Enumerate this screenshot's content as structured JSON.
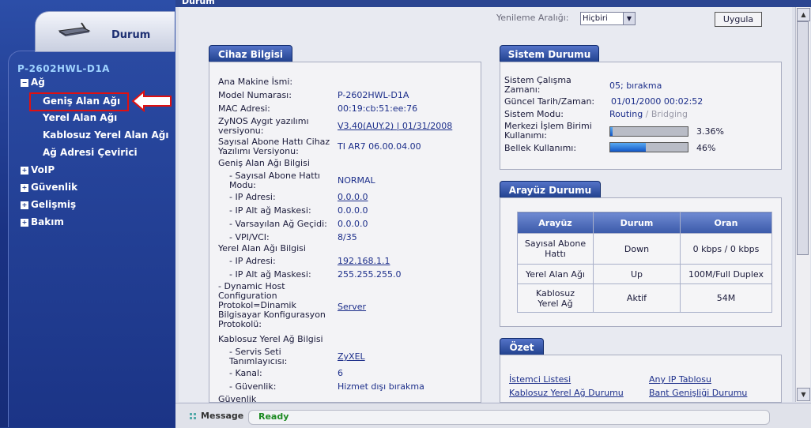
{
  "nav": {
    "tab_label": "Durum",
    "model": "P-2602HWL-D1A",
    "items": [
      {
        "label": "Ağ",
        "icon": "minus-box-icon"
      },
      {
        "label": "Geniş Alan Ağı"
      },
      {
        "label": "Yerel Alan Ağı"
      },
      {
        "label": "Kablosuz Yerel Alan Ağı"
      },
      {
        "label": "Ağ Adresi Çevirici"
      },
      {
        "label": "VoIP",
        "icon": "plus-box-icon"
      },
      {
        "label": "Güvenlik",
        "icon": "plus-box-icon"
      },
      {
        "label": "Gelişmiş",
        "icon": "plus-box-icon"
      },
      {
        "label": "Bakım",
        "icon": "plus-box-icon"
      }
    ]
  },
  "page": {
    "title": "Durum"
  },
  "refresh": {
    "label": "Yenileme Aralığı:",
    "selected": "Hiçbiri",
    "apply": "Uygula"
  },
  "device_info": {
    "header": "Cihaz Bilgisi",
    "rows": [
      {
        "label": "Ana Makine İsmi:",
        "value": ""
      },
      {
        "label": "Model Numarası:",
        "value": "P-2602HWL-D1A"
      },
      {
        "label": "MAC Adresi:",
        "value": "00:19:cb:51:ee:76"
      },
      {
        "label": "ZyNOS Aygıt yazılımı versiyonu:",
        "value": "V3.40(AUY.2) | 01/31/2008"
      },
      {
        "label": "Sayısal Abone Hattı Cihaz Yazılımı Versiyonu:",
        "value": "TI AR7 06.00.04.00"
      },
      {
        "label": "Geniş Alan Ağı Bilgisi",
        "value": ""
      },
      {
        "label": "- Sayısal Abone Hattı Modu:",
        "value": "NORMAL"
      },
      {
        "label": "- IP Adresi:",
        "value": "0.0.0.0"
      },
      {
        "label": "- IP Alt ağ Maskesi:",
        "value": "0.0.0.0"
      },
      {
        "label": "- Varsayılan Ağ Geçidi:",
        "value": "0.0.0.0"
      },
      {
        "label": "- VPI/VCI:",
        "value": "8/35"
      },
      {
        "label": "Yerel Alan Ağı Bilgisi",
        "value": ""
      },
      {
        "label": "- IP Adresi:",
        "value": "192.168.1.1"
      },
      {
        "label": "- IP Alt ağ Maskesi:",
        "value": "255.255.255.0"
      },
      {
        "label": "- Dynamic Host Configuration Protokol=Dinamik Bilgisayar Konfigurasyon Protokolü:",
        "value": "Server"
      },
      {
        "label": "Kablosuz Yerel Ağ Bilgisi",
        "value": ""
      },
      {
        "label": "- Servis Seti Tanımlayıcısı:",
        "value": "ZyXEL"
      },
      {
        "label": "- Kanal:",
        "value": "6"
      },
      {
        "label": "- Güvenlik:",
        "value": "Hizmet dışı bırakma"
      },
      {
        "label": "Güvenlik",
        "value": ""
      }
    ]
  },
  "system_status": {
    "header": "Sistem Durumu",
    "rows": [
      {
        "label": "Sistem Çalışma Zamanı:",
        "value": "05; bırakma"
      },
      {
        "label": "Güncel Tarih/Zaman:",
        "value": "01/01/2000 00:02:52"
      },
      {
        "label": "Sistem Modu:",
        "value_a": "Routing",
        "sep": " / ",
        "value_b": "Bridging"
      },
      {
        "label": "Merkezi İşlem Birimi Kullanımı:",
        "value": "3.36%",
        "fraction": 0.0336
      },
      {
        "label": "Bellek Kullanımı:",
        "value": "46%",
        "fraction": 0.46
      }
    ]
  },
  "interface_status": {
    "header": "Arayüz Durumu",
    "columns": [
      "Arayüz",
      "Durum",
      "Oran"
    ],
    "rows": [
      [
        "Sayısal Abone Hattı",
        "Down",
        "0 kbps / 0 kbps"
      ],
      [
        "Yerel Alan Ağı",
        "Up",
        "100M/Full Duplex"
      ],
      [
        "Kablosuz Yerel Ağ",
        "Aktif",
        "54M"
      ]
    ]
  },
  "summary": {
    "header": "Özet",
    "links": [
      "İstemci Listesi",
      "Any IP Tablosu",
      "Kablosuz Yerel Ağ Durumu",
      "Bant Genişliği Durumu"
    ]
  },
  "statusbar": {
    "label": "Message",
    "text": "Ready"
  },
  "colors": {
    "nav_bg": "#1d3a8a",
    "header_bg": "#2b4591",
    "ready": "#1c8a22",
    "highlight": "#e01010"
  }
}
